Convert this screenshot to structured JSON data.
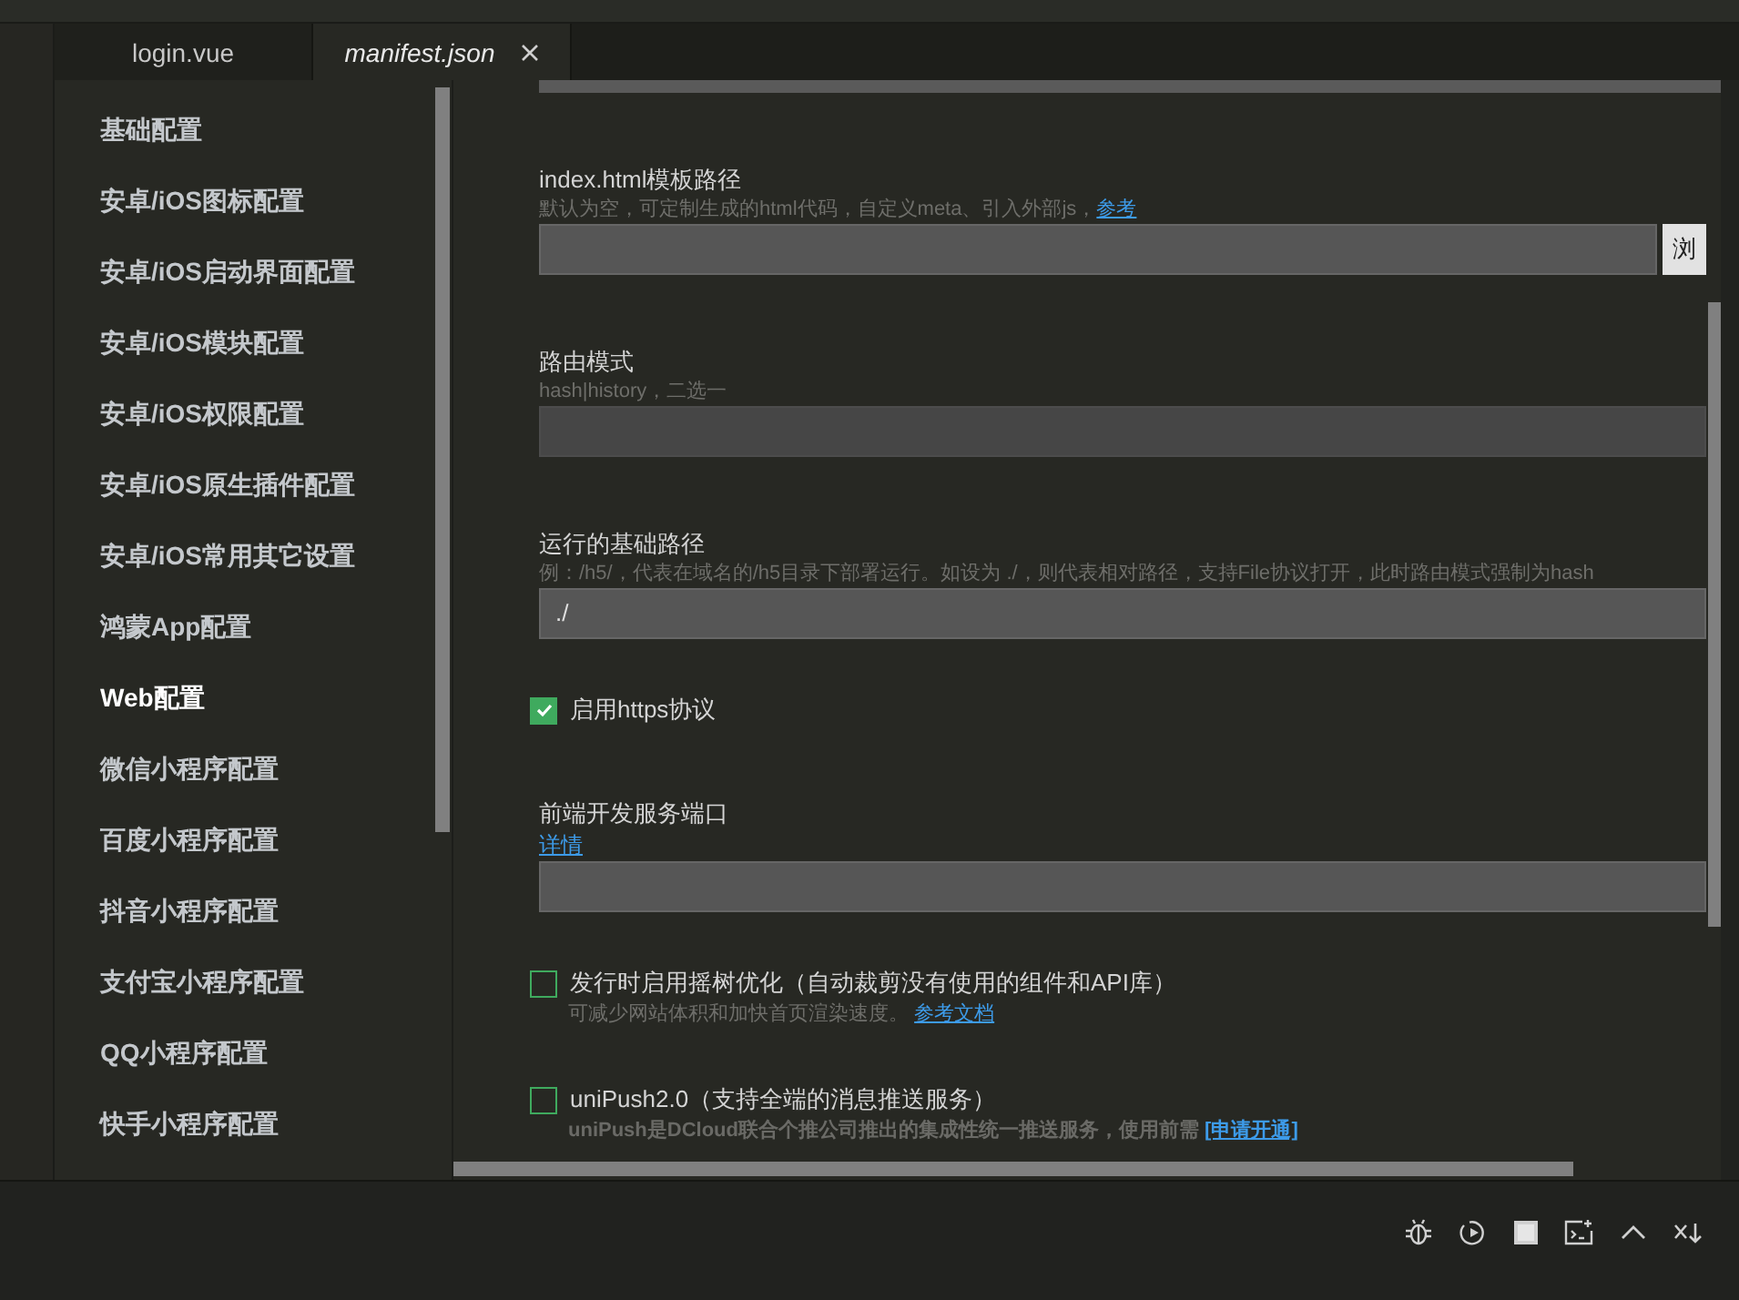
{
  "tabs": [
    {
      "label": "login.vue",
      "selected": false,
      "closable": false
    },
    {
      "label": "manifest.json",
      "selected": true,
      "closable": true
    }
  ],
  "nav": {
    "items": [
      {
        "label": "基础配置",
        "selected": false
      },
      {
        "label": "安卓/iOS图标配置",
        "selected": false
      },
      {
        "label": "安卓/iOS启动界面配置",
        "selected": false
      },
      {
        "label": "安卓/iOS模块配置",
        "selected": false
      },
      {
        "label": "安卓/iOS权限配置",
        "selected": false
      },
      {
        "label": "安卓/iOS原生插件配置",
        "selected": false
      },
      {
        "label": "安卓/iOS常用其它设置",
        "selected": false
      },
      {
        "label": "鸿蒙App配置",
        "selected": false
      },
      {
        "label": "Web配置",
        "selected": true
      },
      {
        "label": "微信小程序配置",
        "selected": false
      },
      {
        "label": "百度小程序配置",
        "selected": false
      },
      {
        "label": "抖音小程序配置",
        "selected": false
      },
      {
        "label": "支付宝小程序配置",
        "selected": false
      },
      {
        "label": "QQ小程序配置",
        "selected": false
      },
      {
        "label": "快手小程序配置",
        "selected": false
      }
    ]
  },
  "settings": [
    {
      "kind": "field",
      "label": "index.html模板路径",
      "hint": "默认为空，可定制生成的html代码，自定义meta、引入外部js，",
      "hint_link": "参考",
      "button": "浏",
      "disabled": false
    },
    {
      "kind": "field",
      "label": "路由模式",
      "hint": "hash|history，二选一",
      "disabled": true
    },
    {
      "kind": "field",
      "label": "运行的基础路径",
      "hint": "例：/h5/，代表在域名的/h5目录下部署运行。如设为 ./，则代表相对路径，支持File协议打开，此时路由模式强制为hash",
      "value": "./",
      "disabled": false
    },
    {
      "kind": "checkbox",
      "label": "启用https协议",
      "checked": true
    },
    {
      "kind": "field",
      "label": "前端开发服务端口",
      "link": "详情",
      "disabled": false
    },
    {
      "kind": "checkbox",
      "label": "发行时启用摇树优化（自动裁剪没有使用的组件和API库）",
      "checked": false,
      "hint": "可减少网站体积和加快首页渲染速度。",
      "hint_link": "参考文档"
    },
    {
      "kind": "checkbox",
      "label": "uniPush2.0（支持全端的消息推送服务）",
      "checked": false,
      "hint": "uniPush是DCloud联合个推公司推出的集成性统一推送服务，使用前需",
      "hint_bold": true,
      "hint_link": "[申请开通]"
    }
  ]
}
